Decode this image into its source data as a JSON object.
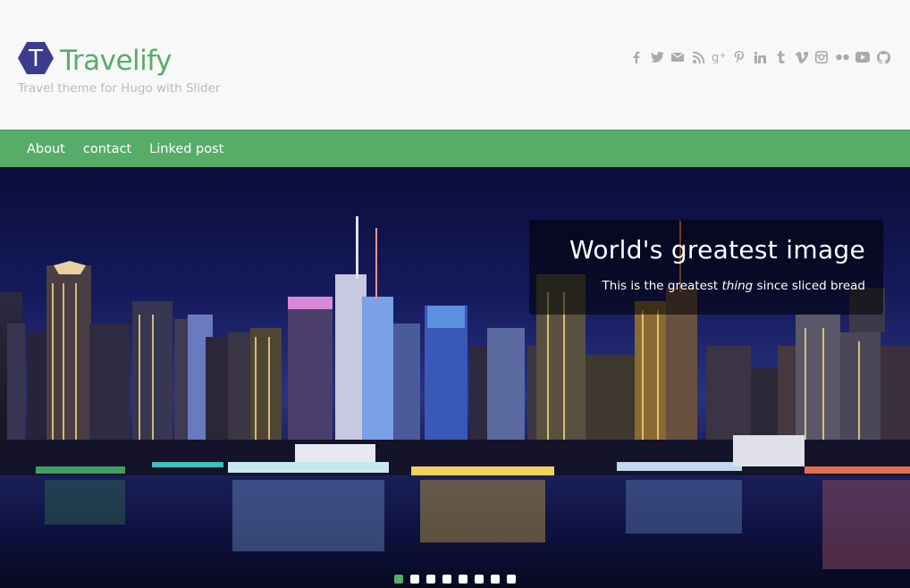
{
  "site": {
    "title": "Travelify",
    "tagline": "Travel theme for Hugo with Slider",
    "brand_color": "#57ad68",
    "logo_letter": "T"
  },
  "social": [
    {
      "name": "facebook-icon",
      "glyph": "f"
    },
    {
      "name": "twitter-icon",
      "glyph": ""
    },
    {
      "name": "email-icon",
      "glyph": ""
    },
    {
      "name": "rss-icon",
      "glyph": ""
    },
    {
      "name": "google-plus-icon",
      "glyph": "g+"
    },
    {
      "name": "pinterest-icon",
      "glyph": ""
    },
    {
      "name": "linkedin-icon",
      "glyph": "in"
    },
    {
      "name": "tumblr-icon",
      "glyph": "t"
    },
    {
      "name": "vimeo-icon",
      "glyph": "v"
    },
    {
      "name": "instagram-icon",
      "glyph": ""
    },
    {
      "name": "flickr-icon",
      "glyph": ""
    },
    {
      "name": "youtube-icon",
      "glyph": ""
    },
    {
      "name": "github-icon",
      "glyph": ""
    }
  ],
  "nav": {
    "items": [
      {
        "label": "About"
      },
      {
        "label": "contact"
      },
      {
        "label": "Linked post"
      }
    ]
  },
  "slider": {
    "caption_title": "World's greatest image",
    "caption_text_before": "This is the greatest ",
    "caption_text_em": "thing",
    "caption_text_after": " since sliced bread",
    "slide_count": 8,
    "active_slide": 1
  }
}
